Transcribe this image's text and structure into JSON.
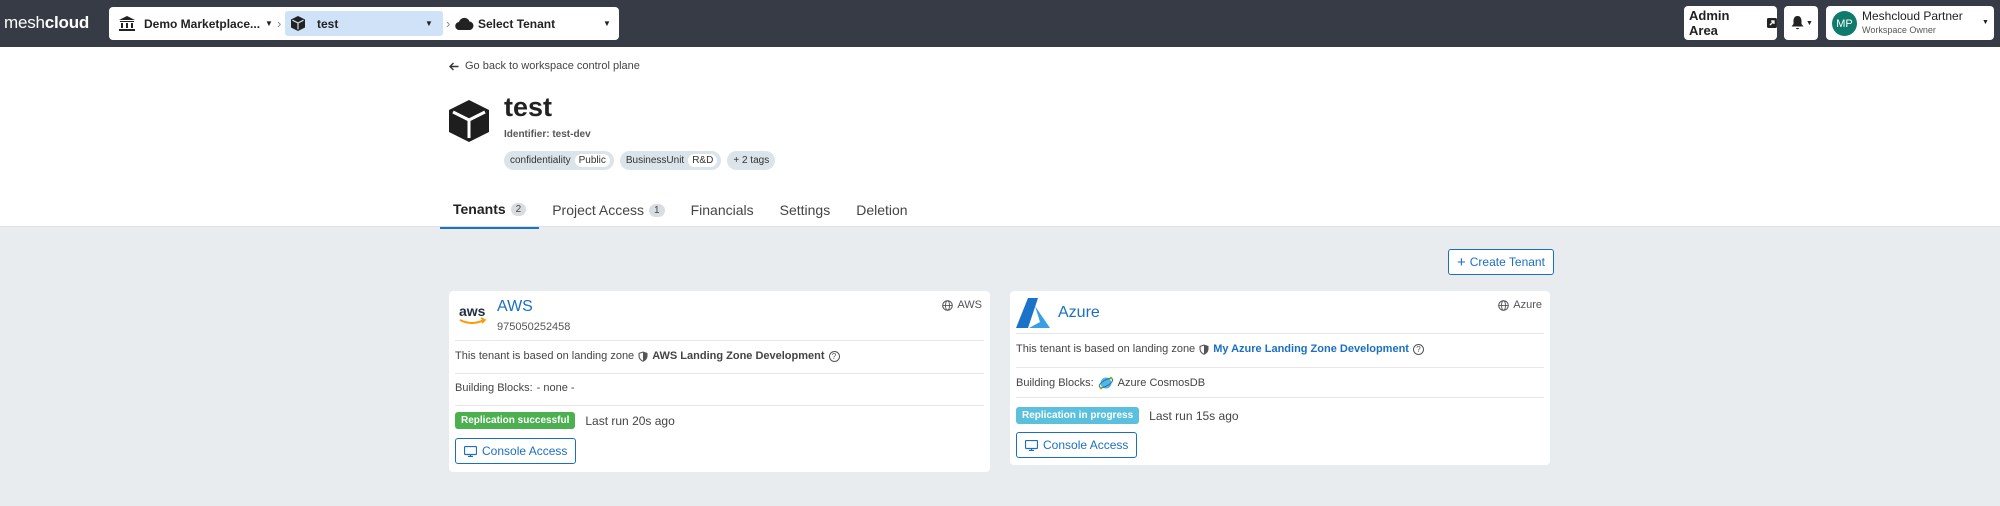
{
  "app": {
    "logo_light": "mesh",
    "logo_bold": "cloud"
  },
  "breadcrumb": {
    "workspace": "Demo Marketplace...",
    "project": "test",
    "tenant": "Select Tenant"
  },
  "topnav": {
    "admin_area": "Admin Area",
    "user_initials": "MP",
    "user_name": "Meshcloud Partner",
    "user_role": "Workspace Owner"
  },
  "header": {
    "back_link": "Go back to workspace control plane",
    "title": "test",
    "identifier": "Identifier: test-dev",
    "tags": [
      {
        "key": "confidentiality",
        "value": "Public"
      },
      {
        "key": "BusinessUnit",
        "value": "R&D"
      }
    ],
    "more_tags": "+ 2 tags"
  },
  "tabs": [
    {
      "label": "Tenants",
      "count": "2"
    },
    {
      "label": "Project Access",
      "count": "1"
    },
    {
      "label": "Financials"
    },
    {
      "label": "Settings"
    },
    {
      "label": "Deletion"
    }
  ],
  "actions": {
    "create_tenant": "Create Tenant"
  },
  "tenants": [
    {
      "name": "AWS",
      "account_id": "975050252458",
      "platform": "AWS",
      "logo_text": "aws",
      "landing_zone_prefix": "This tenant is based on landing zone",
      "landing_zone": "AWS Landing Zone Development",
      "building_blocks_label": "Building Blocks:",
      "building_blocks": "- none -",
      "status": "Replication successful",
      "last_run": "Last run 20s ago",
      "console": "Console Access"
    },
    {
      "name": "Azure",
      "platform": "Azure",
      "landing_zone_prefix": "This tenant is based on landing zone",
      "landing_zone": "My Azure Landing Zone Development",
      "building_blocks_label": "Building Blocks:",
      "building_blocks": "Azure CosmosDB",
      "status": "Replication in progress",
      "last_run": "Last run 15s ago",
      "console": "Console Access"
    }
  ],
  "colors": {
    "topbar": "#363b45",
    "accent": "#1a6fc4",
    "success": "#4caf50",
    "progress": "#5bc0de",
    "avatar": "#0f7b6c"
  }
}
